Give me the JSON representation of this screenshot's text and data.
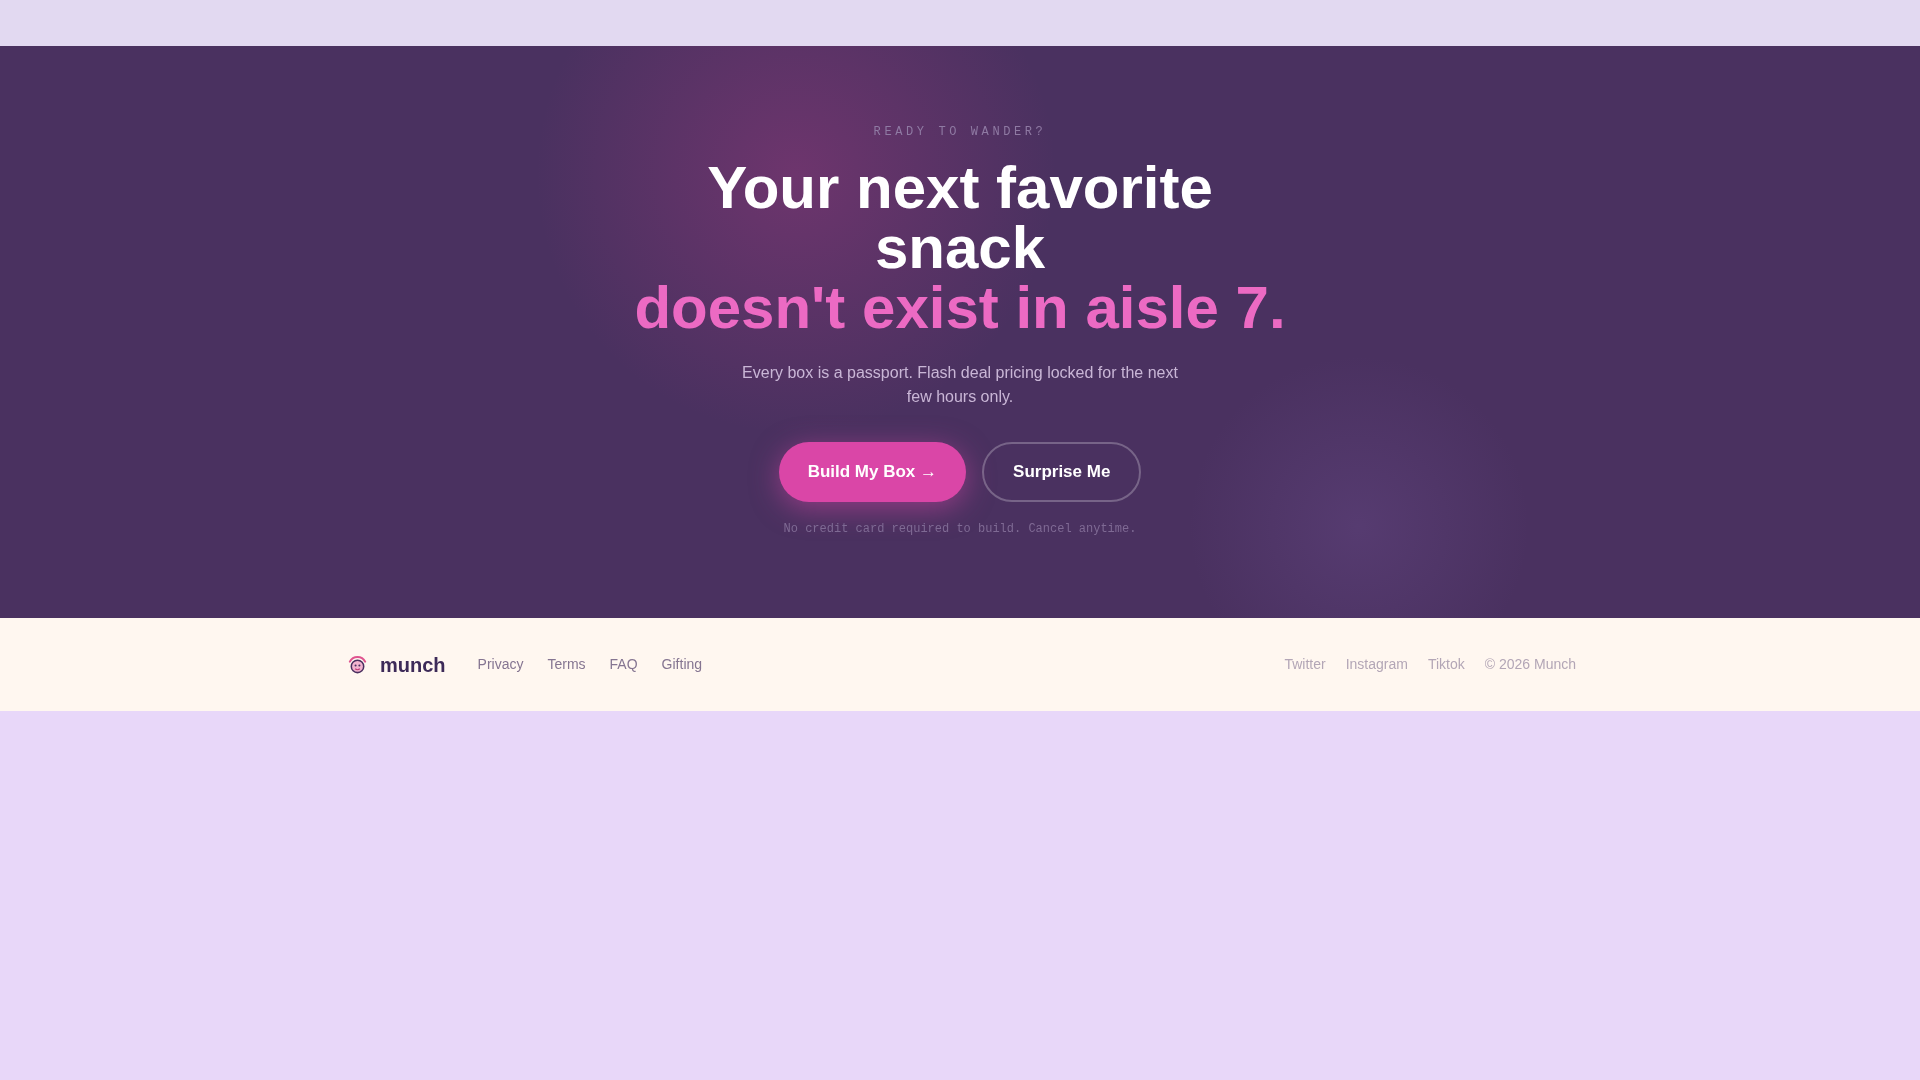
{
  "hero": {
    "eyebrow": "READY TO WANDER?",
    "heading": "Your next favorite snack",
    "heading_highlight": "doesn't exist in aisle 7.",
    "subtitle": "Every box is a passport. Flash deal pricing locked for the next few hours only.",
    "buttons": [
      {
        "label": "Build My Box →",
        "kind": "primary"
      },
      {
        "label": "Surprise Me",
        "kind": "secondary"
      }
    ],
    "note": "No credit card required to build. Cancel anytime."
  },
  "footer": {
    "brand": "munch",
    "links": [
      "Privacy",
      "Terms",
      "FAQ",
      "Gifting"
    ],
    "social_links": [
      "Twitter",
      "Instagram",
      "Tiktok"
    ],
    "copyright": "© 2026 Munch"
  }
}
